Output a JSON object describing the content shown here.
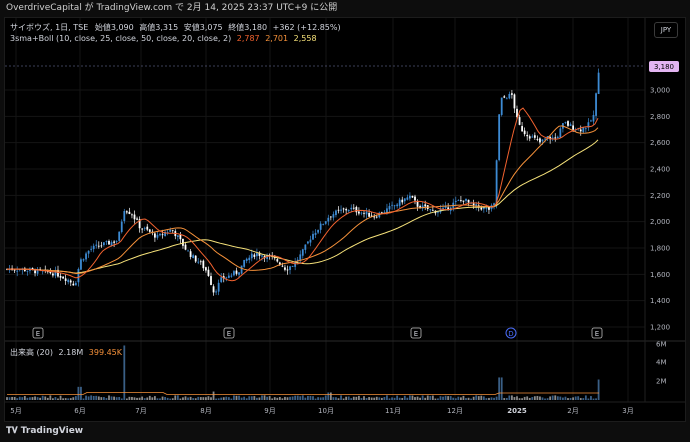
{
  "topbar": {
    "text": "OverdriveCapital が TradingView.com で 2月 14, 2025 23:37 UTC+9 に公開"
  },
  "legend": {
    "symbol": "サイボウズ, 1日, TSE",
    "open_label": "始値",
    "open": "3,090",
    "high_label": "高値",
    "high": "3,315",
    "low_label": "安値",
    "low": "3,075",
    "close_label": "終値",
    "close": "3,180",
    "change": "+362 (+12.85%)",
    "indicator": "3sma+Boll (10, close, 25, close, 50, close, 20, close, 2)",
    "ind_v1": "2,787",
    "ind_v2": "2,701",
    "ind_v3": "2,558"
  },
  "currency": "JPY",
  "volume_legend": {
    "label": "出来高 (20)",
    "value": "2.18M",
    "ma": "399.45K"
  },
  "price_axis": {
    "ticks": [
      "3,000",
      "2,800",
      "2,600",
      "2,400",
      "2,200",
      "2,000",
      "1,800",
      "1,600",
      "1,400",
      "1,200"
    ],
    "last_price": "3,180"
  },
  "volume_axis": {
    "ticks": [
      "6M",
      "4M",
      "2M"
    ]
  },
  "time_axis": {
    "ticks": [
      "5月",
      "6月",
      "7月",
      "8月",
      "9月",
      "10月",
      "11月",
      "12月",
      "2025",
      "2月",
      "3月"
    ]
  },
  "events": {
    "earnings_label": "E",
    "dividend_label": "D"
  },
  "footer": {
    "brand": "TradingView"
  },
  "colors": {
    "up": "#3d8bd4",
    "down": "#ffffff",
    "sma10": "#f2622f",
    "sma25": "#f5913a",
    "sma50": "#f6e27a",
    "last_price_badge": "#e3b5f2"
  },
  "chart_data": {
    "type": "line",
    "title": "サイボウズ, 1日, TSE",
    "ylim": [
      1200,
      3400
    ],
    "x": [
      "5月",
      "6月",
      "7月",
      "8月",
      "9月",
      "10月",
      "11月",
      "12月",
      "2025",
      "2月"
    ],
    "series": [
      {
        "name": "3sma+Boll 10",
        "values": [
          1640,
          1620,
          2040,
          1600,
          1740,
          2100,
          2150,
          2140,
          2880,
          2787
        ]
      },
      {
        "name": "3sma+Boll 25",
        "values": [
          1630,
          1610,
          1980,
          1700,
          1700,
          2020,
          2120,
          2120,
          2600,
          2701
        ]
      },
      {
        "name": "3sma+Boll 50",
        "values": [
          1800,
          1640,
          1900,
          1860,
          1680,
          1870,
          1960,
          2080,
          2260,
          2558
        ]
      }
    ],
    "volume": {
      "ylim": [
        0,
        6000000
      ],
      "max": 5800000,
      "last": 2180000,
      "ma20": 399450
    }
  }
}
